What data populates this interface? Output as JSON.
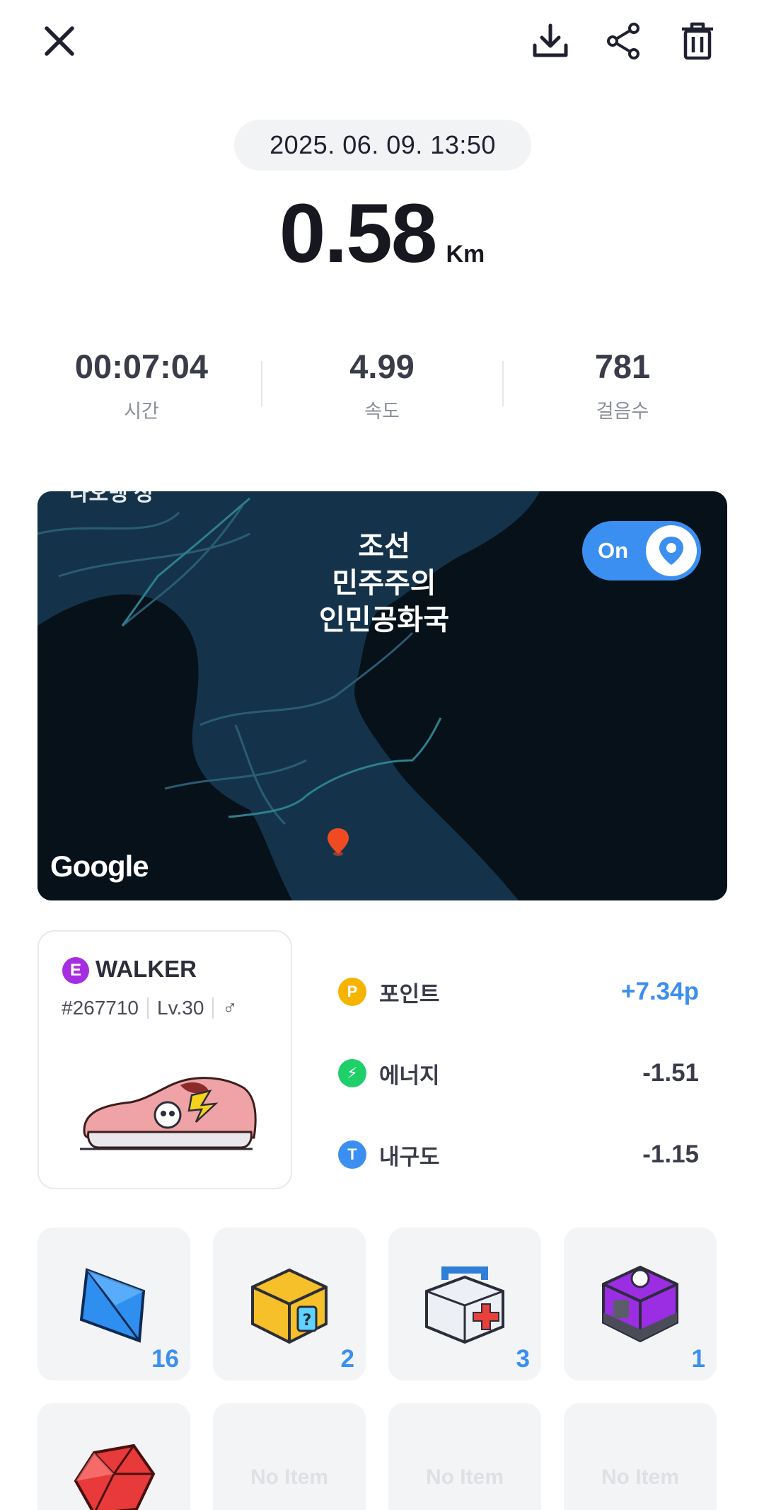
{
  "header": {
    "close_icon": "close-icon",
    "download_icon": "download-icon",
    "share_icon": "share-icon",
    "delete_icon": "trash-icon"
  },
  "session": {
    "datetime": "2025. 06. 09. 13:50",
    "distance": "0.58",
    "distance_unit": "Km"
  },
  "stats": [
    {
      "value": "00:07:04",
      "label": "시간"
    },
    {
      "value": "4.99",
      "label": "속도"
    },
    {
      "value": "781",
      "label": "걸음수"
    }
  ],
  "map": {
    "country_label_1": "조선",
    "country_label_2": "민주주의",
    "country_label_3": "인민공화국",
    "top_label": "나오뱅 성",
    "attribution": "Google",
    "toggle_label": "On"
  },
  "walker": {
    "grade": "E",
    "type": "WALKER",
    "id": "#267710",
    "level": "Lv.30",
    "gender": "♂"
  },
  "rewards": [
    {
      "icon": "P",
      "label": "포인트",
      "value": "+7.34p",
      "color": "#f6b400"
    },
    {
      "icon": "⚡",
      "label": "에너지",
      "value": "-1.51",
      "color": "#1fcf6a"
    },
    {
      "icon": "T",
      "label": "내구도",
      "value": "-1.15",
      "color": "#3b8ff0"
    }
  ],
  "items": [
    {
      "name": "blue-crystal",
      "count": "16"
    },
    {
      "name": "mystery-box-yellow",
      "count": "2"
    },
    {
      "name": "repair-kit",
      "count": "3"
    },
    {
      "name": "mystery-box-purple",
      "count": "1"
    },
    {
      "name": "red-gem",
      "count": ""
    },
    {
      "name": "empty",
      "label": "No Item"
    },
    {
      "name": "empty",
      "label": "No Item"
    },
    {
      "name": "empty",
      "label": "No Item"
    }
  ],
  "colors": {
    "accent": "#3b8ff0",
    "map_land": "#14334a",
    "map_sea": "#071119"
  }
}
